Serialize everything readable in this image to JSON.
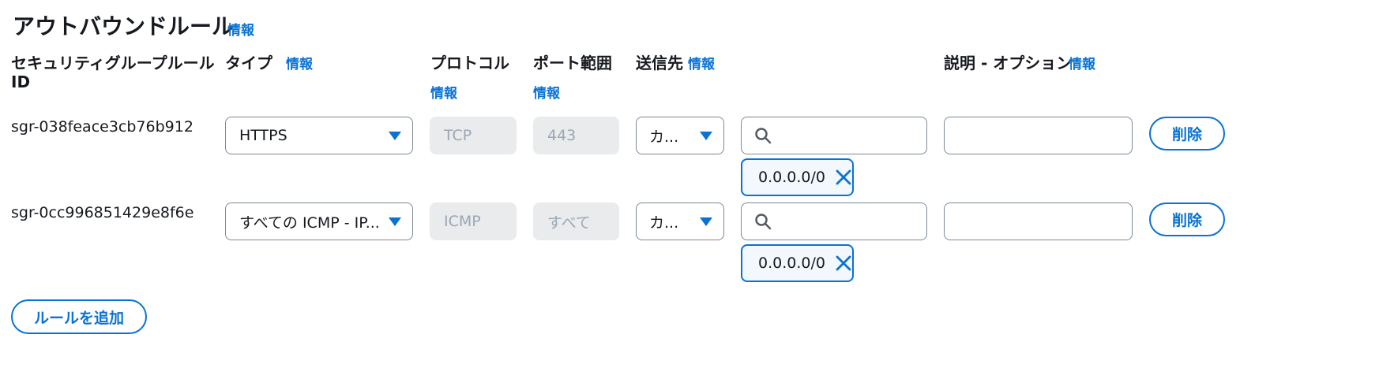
{
  "section": {
    "title": "アウトバウンドルール",
    "info": "情報"
  },
  "headers": {
    "rule_id": "セキュリティグループルール",
    "rule_id_line2": "ID",
    "type": "タイプ",
    "type_info": "情報",
    "protocol": "プロトコル",
    "protocol_info": "情報",
    "port_range": "ポート範囲",
    "port_info": "情報",
    "destination": "送信先",
    "destination_info": "情報",
    "description": "説明 - オプション",
    "description_info": "情報"
  },
  "rules": [
    {
      "id": "sgr-038feace3cb76b912",
      "type": "HTTPS",
      "protocol": "TCP",
      "port_range": "443",
      "destination_type": "カ...",
      "destination_token": "0.0.0.0/0",
      "delete_label": "削除"
    },
    {
      "id": "sgr-0cc996851429e8f6e",
      "type": "すべての ICMP - IP...",
      "protocol": "ICMP",
      "port_range": "すべて",
      "destination_type": "カ...",
      "destination_token": "0.0.0.0/0",
      "delete_label": "削除"
    }
  ],
  "add_rule_label": "ルールを追加",
  "colors": {
    "accent": "#0972d3",
    "disabled_bg": "#e9ebed",
    "disabled_text": "#9ba7b6",
    "border": "#7d8998"
  },
  "icons": {
    "search": "search-icon",
    "dropdown": "caret-down-icon",
    "remove": "close-icon"
  }
}
